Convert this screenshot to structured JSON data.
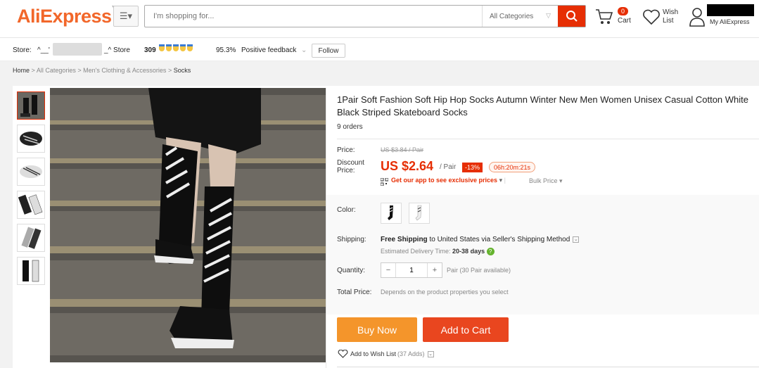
{
  "header": {
    "logo": "AliExpress",
    "search_placeholder": "I'm shopping for...",
    "search_category": "All Categories",
    "cart_count": "0",
    "cart_label": "Cart",
    "wish_line1": "Wish",
    "wish_line2": "List",
    "account_label": "My AliExpress"
  },
  "store": {
    "label": "Store:",
    "name_prefix": "^__'",
    "name_suffix": "_^ Store",
    "score": "309",
    "feedback_pct": "95.3%",
    "feedback_label": "Positive feedback",
    "follow_label": "Follow"
  },
  "breadcrumb": {
    "home": "Home",
    "sep": ">",
    "c1": "All Categories",
    "c2": "Men's Clothing & Accessories",
    "c3": "Socks"
  },
  "product": {
    "title": "1Pair Soft Fashion Soft Hip Hop Socks Autumn Winter New Men Women Unisex Casual Cotton White Black Striped Skateboard Socks",
    "orders": "9 orders",
    "price_label": "Price:",
    "original_price": "US $3.84 / Pair",
    "discount_label_1": "Discount",
    "discount_label_2": "Price:",
    "discount_price": "US $2.64",
    "unit": "/ Pair",
    "discount_pct": "-13%",
    "timer": "06h:20m:21s",
    "app_promo": "Get our app to see exclusive prices",
    "bulk_price": "Bulk Price",
    "color_label": "Color:",
    "shipping_label": "Shipping:",
    "shipping_free": "Free Shipping",
    "shipping_to": "to",
    "shipping_country": "United States via Seller's Shipping Method",
    "delivery_label": "Estimated Delivery Time:",
    "delivery_days": "20-38 days",
    "quantity_label": "Quantity:",
    "quantity_value": "1",
    "availability": "Pair (30 Pair available)",
    "total_label": "Total Price:",
    "total_note": "Depends on the product properties you select",
    "buy_now": "Buy Now",
    "add_to_cart": "Add to Cart",
    "wishlist": "Add to Wish List",
    "wishlist_count": "(37 Adds)"
  },
  "colors": {
    "brand": "#f2672a",
    "primary_red": "#e62e04",
    "buy_now": "#f4952b",
    "add_cart": "#e9461f"
  }
}
